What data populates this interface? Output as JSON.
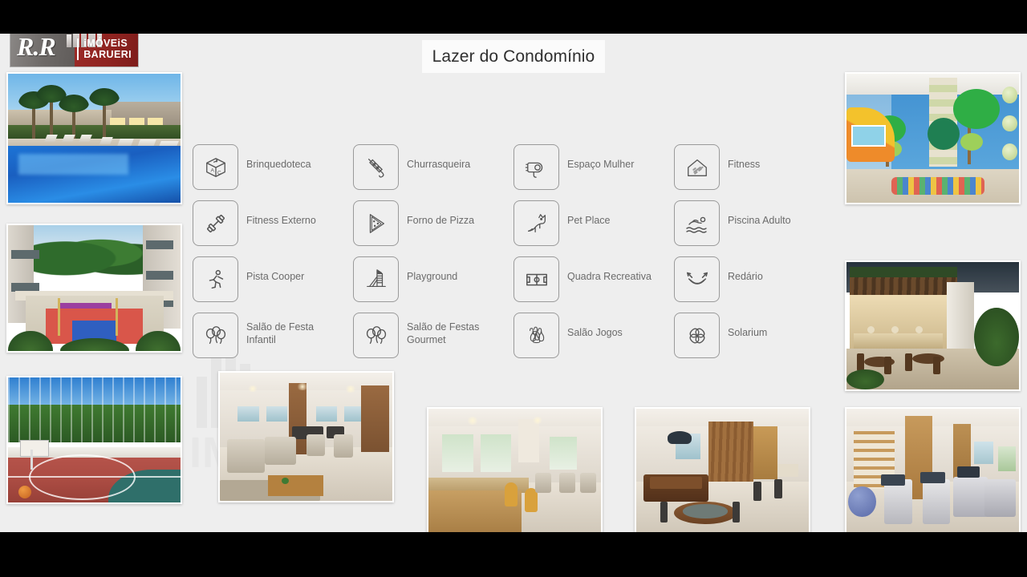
{
  "slide": {
    "title": "Lazer do Condomínio",
    "background_color": "#eeeeee",
    "letterbox_color": "#000000"
  },
  "logo": {
    "wordmark": "R.R",
    "line1": "iMÓVEiS",
    "line2": "BARUERI",
    "left_color": "#6e6a68",
    "right_color": "#8e2320"
  },
  "watermark": {
    "text": "RR IMÓVEIS",
    "color": "#e2e2e2"
  },
  "amenities": [
    {
      "label": "Brinquedoteca",
      "icon": "toy-block-icon"
    },
    {
      "label": "Churrasqueira",
      "icon": "skewer-icon"
    },
    {
      "label": "Espaço Mulher",
      "icon": "hair-dryer-icon"
    },
    {
      "label": "Fitness",
      "icon": "gym-house-icon"
    },
    {
      "label": "Fitness Externo",
      "icon": "dumbbell-icon"
    },
    {
      "label": "Forno de Pizza",
      "icon": "pizza-slice-icon"
    },
    {
      "label": "Pet Place",
      "icon": "dog-icon"
    },
    {
      "label": "Piscina Adulto",
      "icon": "swimmer-icon"
    },
    {
      "label": "Pista Cooper",
      "icon": "runner-icon"
    },
    {
      "label": "Playground",
      "icon": "playground-slide-icon"
    },
    {
      "label": "Quadra Recreativa",
      "icon": "sports-field-icon"
    },
    {
      "label": "Redário",
      "icon": "hammock-icon"
    },
    {
      "label": "Salão de Festa Infantil",
      "icon": "balloons-icon"
    },
    {
      "label": "Salão de Festas Gourmet",
      "icon": "balloons-icon"
    },
    {
      "label": "Salão Jogos",
      "icon": "bowling-pins-icon"
    },
    {
      "label": "Solarium",
      "icon": "flower-pinwheel-icon"
    }
  ],
  "photos": {
    "left_column": [
      {
        "name": "swimming-pool-photo",
        "caption": "Piscina com espreguiçadeiras e palmeiras"
      },
      {
        "name": "playground-courtyard-photo",
        "caption": "Pátio com playground e quadra colorida"
      }
    ],
    "right_column": [
      {
        "name": "kids-playroom-photo",
        "caption": "Brinquedoteca infantil com árvores pintadas"
      },
      {
        "name": "gourmet-pergola-photo",
        "caption": "Espaço gourmet com pergolado e mesas"
      }
    ],
    "bottom_row": [
      {
        "name": "basketball-court-photo",
        "caption": "Quadra poliesportiva ao ar livre"
      },
      {
        "name": "lounge-hall-photo",
        "caption": "Salão de festas com lounge"
      },
      {
        "name": "gourmet-bar-photo",
        "caption": "Salão gourmet com bancada e banquetas"
      },
      {
        "name": "games-room-photo",
        "caption": "Salão de jogos com bilhar e mesa de carteado"
      },
      {
        "name": "fitness-gym-photo",
        "caption": "Academia com esteiras e bicicletas"
      }
    ]
  }
}
